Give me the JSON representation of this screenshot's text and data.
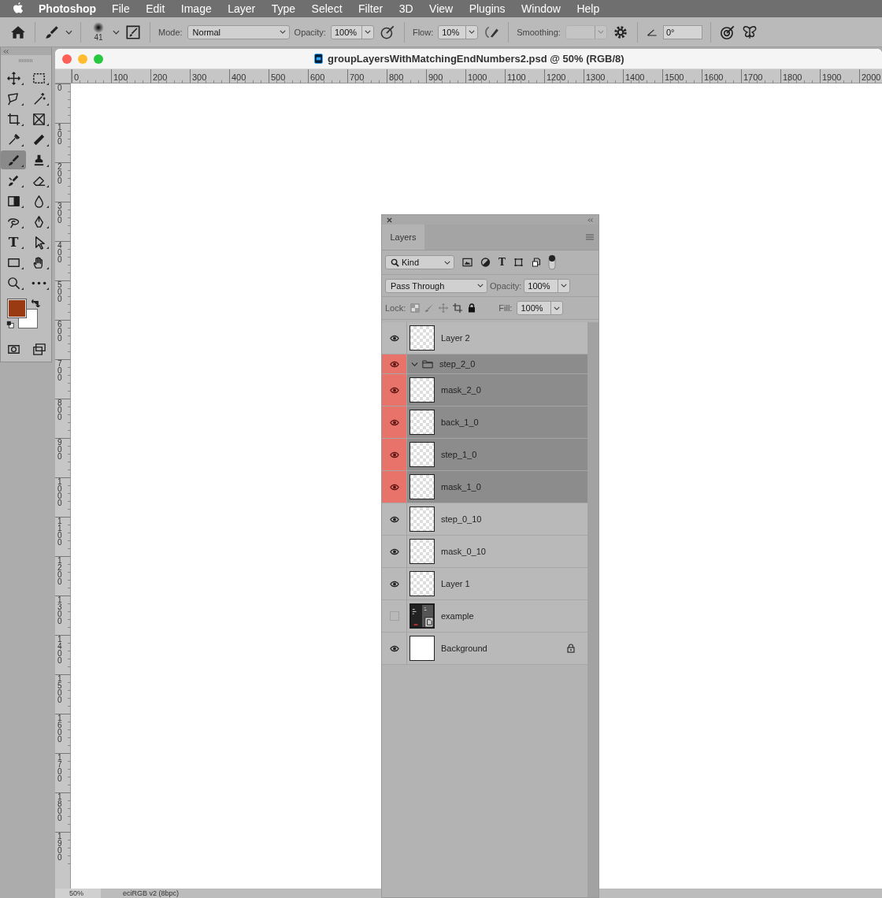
{
  "menu_bar": {
    "app": "Photoshop",
    "items": [
      "File",
      "Edit",
      "Image",
      "Layer",
      "Type",
      "Select",
      "Filter",
      "3D",
      "View",
      "Plugins",
      "Window",
      "Help"
    ]
  },
  "options_bar": {
    "brush_size": "41",
    "mode_label": "Mode:",
    "mode": "Normal",
    "opacity_label": "Opacity:",
    "opacity": "100%",
    "flow_label": "Flow:",
    "flow": "10%",
    "smoothing_label": "Smoothing:",
    "smoothing_disabled": true,
    "angle": "0°"
  },
  "tools": [
    {
      "kind": "move",
      "selected": false
    },
    {
      "kind": "marquee",
      "selected": false
    },
    {
      "kind": "lasso",
      "selected": false
    },
    {
      "kind": "wand",
      "selected": false
    },
    {
      "kind": "crop",
      "selected": false
    },
    {
      "kind": "frame",
      "selected": false
    },
    {
      "kind": "eyedropper",
      "selected": false
    },
    {
      "kind": "bandage",
      "selected": false
    },
    {
      "kind": "brush",
      "selected": true
    },
    {
      "kind": "stamp",
      "selected": false
    },
    {
      "kind": "history",
      "selected": false
    },
    {
      "kind": "eraser",
      "selected": false
    },
    {
      "kind": "gradient",
      "selected": false
    },
    {
      "kind": "drop",
      "selected": false
    },
    {
      "kind": "swirl",
      "selected": false
    },
    {
      "kind": "pen",
      "selected": false
    },
    {
      "kind": "type",
      "glyph": "T",
      "selected": false
    },
    {
      "kind": "path-select",
      "selected": false
    },
    {
      "kind": "rectangle",
      "selected": false
    },
    {
      "kind": "hand",
      "selected": false
    },
    {
      "kind": "zoom",
      "selected": false
    },
    {
      "kind": "more",
      "selected": false
    }
  ],
  "mode_tools": [
    {
      "kind": "quickmask",
      "selected": false
    },
    {
      "kind": "screen",
      "selected": false
    }
  ],
  "document": {
    "title": "groupLayersWithMatchingEndNumbers2.psd @ 50% (RGB/8)",
    "h_ruler": [
      "0",
      "100",
      "200",
      "300",
      "400",
      "500",
      "600",
      "700",
      "800",
      "900",
      "1000",
      "1100",
      "1200",
      "1300",
      "1400",
      "1500",
      "1600",
      "1700",
      "1800",
      "1900",
      "2000"
    ],
    "v_ruler": [
      "0",
      "100",
      "200",
      "300",
      "400",
      "500",
      "600",
      "700",
      "800",
      "900",
      "1000",
      "1100",
      "1200",
      "1300",
      "1400",
      "1500",
      "1600",
      "1700",
      "1800",
      "1900"
    ],
    "status_zoom": "50%",
    "status_profile": "eciRGB v2 (8bpc)"
  },
  "layers_panel": {
    "tab": {
      "label": "Layers",
      "selected": true
    },
    "filter": "Kind",
    "filter_type_glyph": "T",
    "blend_mode": "Pass Through",
    "opacity_label": "Opacity:",
    "opacity": "100%",
    "lock_label": "Lock:",
    "fill_label": "Fill:",
    "fill": "100%",
    "layers": [
      {
        "name": "Layer 2",
        "kind": "pixel",
        "visible": true,
        "selected": false,
        "locked": false
      },
      {
        "name": "step_2_0",
        "kind": "group",
        "visible": true,
        "selected": true,
        "locked": false,
        "expanded": true
      },
      {
        "name": "mask_2_0",
        "kind": "pixel",
        "visible": true,
        "selected": true,
        "locked": false
      },
      {
        "name": "back_1_0",
        "kind": "pixel",
        "visible": true,
        "selected": true,
        "locked": false
      },
      {
        "name": "step_1_0",
        "kind": "pixel",
        "visible": true,
        "selected": true,
        "locked": false
      },
      {
        "name": "mask_1_0",
        "kind": "pixel",
        "visible": true,
        "selected": true,
        "locked": false
      },
      {
        "name": "step_0_10",
        "kind": "pixel",
        "visible": true,
        "selected": false,
        "locked": false
      },
      {
        "name": "mask_0_10",
        "kind": "pixel",
        "visible": true,
        "selected": false,
        "locked": false
      },
      {
        "name": "Layer 1",
        "kind": "pixel",
        "visible": true,
        "selected": false,
        "locked": false
      },
      {
        "name": "example",
        "kind": "smart",
        "visible": false,
        "selected": false,
        "locked": false
      },
      {
        "name": "Background",
        "kind": "background",
        "visible": true,
        "selected": false,
        "locked": true
      }
    ]
  }
}
